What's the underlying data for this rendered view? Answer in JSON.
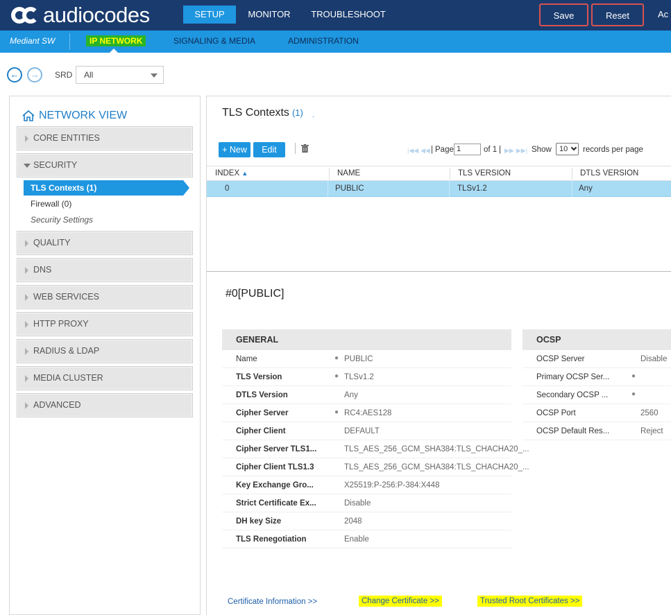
{
  "header": {
    "logo_text": "audiocodes",
    "nav": [
      "SETUP",
      "MONITOR",
      "TROUBLESHOOT"
    ],
    "save_label": "Save",
    "reset_label": "Reset",
    "overflow_label": "Ac"
  },
  "subheader": {
    "product": "Mediant SW",
    "nav": [
      "IP NETWORK",
      "SIGNALING & MEDIA",
      "ADMINISTRATION"
    ]
  },
  "toolbar": {
    "srd_label": "SRD",
    "srd_value": "All"
  },
  "sidebar": {
    "title": "NETWORK VIEW",
    "sections": [
      "CORE ENTITIES",
      "SECURITY",
      "QUALITY",
      "DNS",
      "WEB SERVICES",
      "HTTP PROXY",
      "RADIUS & LDAP",
      "MEDIA CLUSTER",
      "ADVANCED"
    ],
    "security_items": [
      "TLS Contexts (1)",
      "Firewall (0)",
      "Security Settings"
    ]
  },
  "table": {
    "title": "TLS Contexts",
    "count": "(1)",
    "new_label": "+ New",
    "edit_label": "Edit",
    "page_label": "Page",
    "page_value": "1",
    "of_label": "of 1",
    "show_label": "Show",
    "show_value": "10",
    "records_label": "records per page",
    "columns": [
      "INDEX",
      "NAME",
      "TLS VERSION",
      "DTLS VERSION"
    ],
    "rows": [
      {
        "index": "0",
        "name": "PUBLIC",
        "tls": "TLSv1.2",
        "dtls": "Any"
      }
    ]
  },
  "detail": {
    "title": "#0[PUBLIC]",
    "general": {
      "heading": "GENERAL",
      "fields": [
        {
          "label": "Name",
          "value": "PUBLIC"
        },
        {
          "label": "TLS Version",
          "value": "TLSv1.2"
        },
        {
          "label": "DTLS Version",
          "value": "Any"
        },
        {
          "label": "Cipher Server",
          "value": "RC4:AES128"
        },
        {
          "label": "Cipher Client",
          "value": "DEFAULT"
        },
        {
          "label": "Cipher Server TLS1...",
          "value": "TLS_AES_256_GCM_SHA384:TLS_CHACHA20_..."
        },
        {
          "label": "Cipher Client TLS1.3",
          "value": "TLS_AES_256_GCM_SHA384:TLS_CHACHA20_..."
        },
        {
          "label": "Key Exchange Gro...",
          "value": "X25519:P-256:P-384:X448"
        },
        {
          "label": "Strict Certificate Ex...",
          "value": "Disable"
        },
        {
          "label": "DH key Size",
          "value": "2048"
        },
        {
          "label": "TLS Renegotiation",
          "value": "Enable"
        }
      ]
    },
    "ocsp": {
      "heading": "OCSP",
      "fields": [
        {
          "label": "OCSP Server",
          "value": "Disable"
        },
        {
          "label": "Primary OCSP Ser...",
          "value": ""
        },
        {
          "label": "Secondary OCSP ...",
          "value": ""
        },
        {
          "label": "OCSP Port",
          "value": "2560"
        },
        {
          "label": "OCSP Default Res...",
          "value": "Reject"
        }
      ]
    }
  },
  "links": {
    "cert_info": "Certificate Information  >>",
    "change_cert": "Change Certificate  >>",
    "trusted_root": "Trusted Root Certificates  >>"
  }
}
